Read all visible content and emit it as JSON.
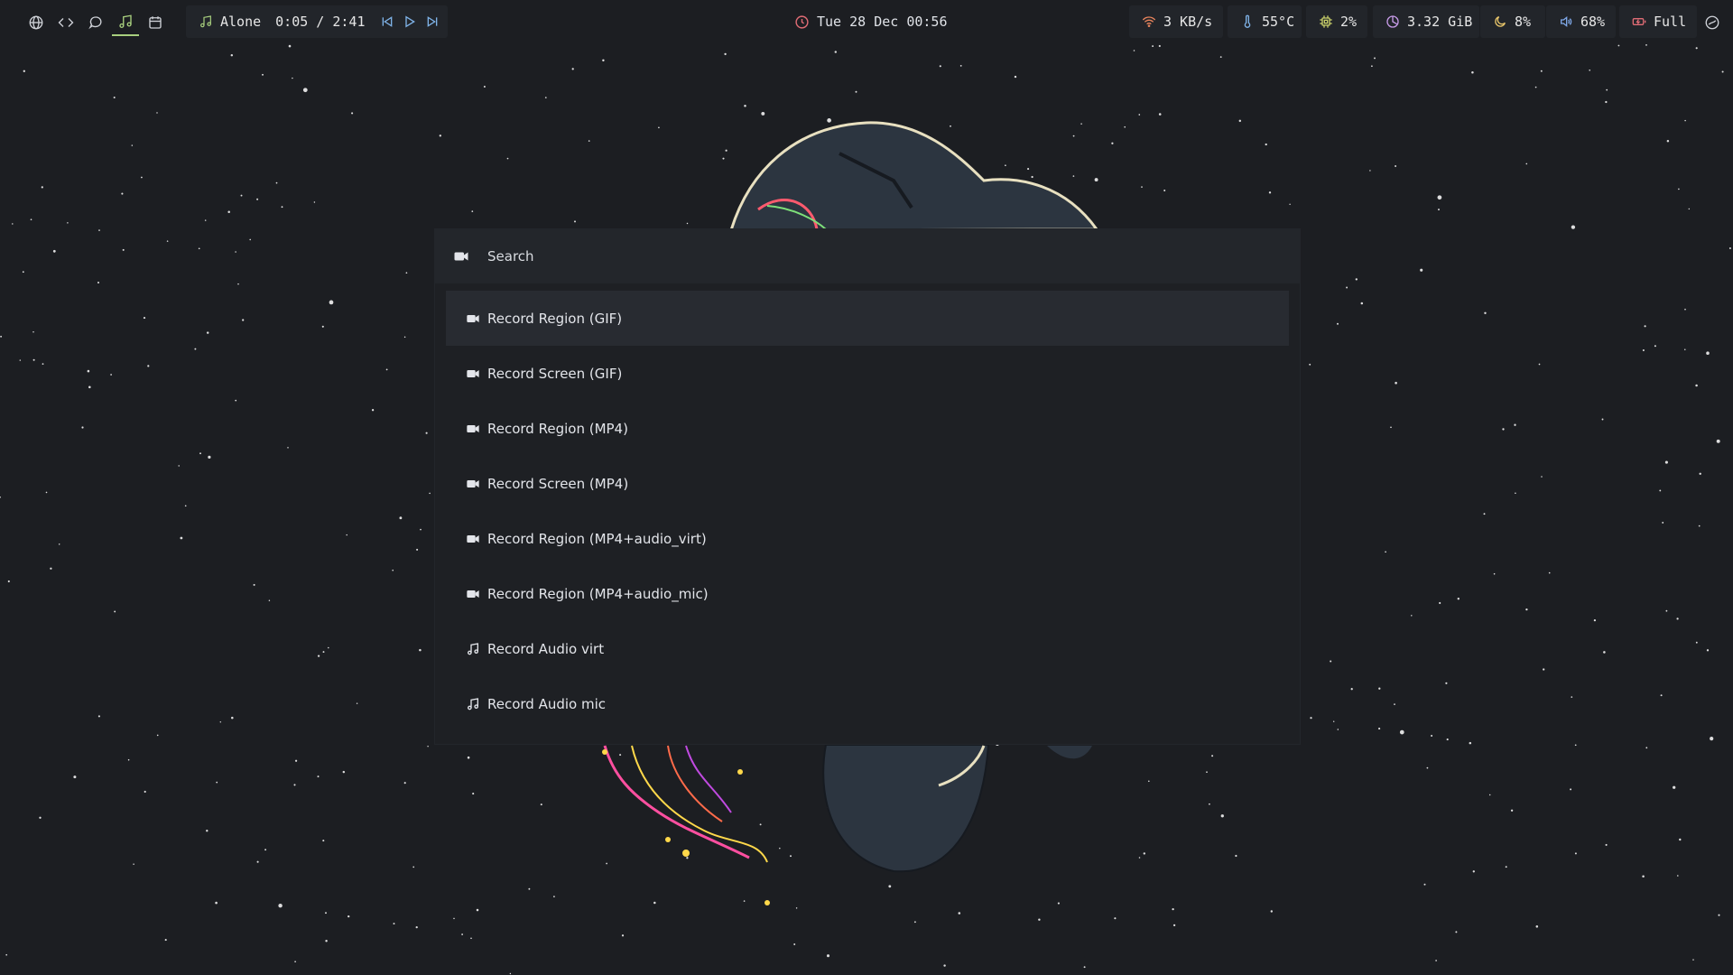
{
  "bar": {
    "workspaces": [
      {
        "icon": "globe-icon",
        "active": false
      },
      {
        "icon": "code-icon",
        "active": false
      },
      {
        "icon": "chat-icon",
        "active": false
      },
      {
        "icon": "music-note-icon",
        "active": true
      },
      {
        "icon": "calendar-icon",
        "active": false
      }
    ],
    "media": {
      "title": "Alone",
      "time": "0:05 / 2:41",
      "icon": "music-note-icon",
      "buttons": [
        "previous-icon",
        "play-icon",
        "next-icon"
      ]
    },
    "clock": {
      "text": "Tue 28 Dec 00:56",
      "icon": "clock-icon"
    },
    "status": {
      "network": {
        "text": "3 KB/s",
        "icon": "wifi-icon",
        "color": "#e8845c"
      },
      "temperature": {
        "text": "55°C",
        "icon": "thermometer-icon",
        "color": "#7fb3e8"
      },
      "cpu": {
        "text": "2%",
        "icon": "cpu-icon",
        "color": "#c9d06a"
      },
      "memory": {
        "text": "3.32 GiB",
        "icon": "memory-icon",
        "color": "#c79be8"
      },
      "brightness": {
        "text": "8%",
        "icon": "moon-icon",
        "color": "#e8c56a"
      },
      "volume": {
        "text": "68%",
        "icon": "speaker-icon",
        "color": "#7fa8e8"
      },
      "battery": {
        "text": "Full",
        "icon": "battery-icon",
        "color": "#e06c75"
      },
      "power": {
        "icon": "power-icon"
      }
    },
    "accent": "#a8cf7e"
  },
  "launcher": {
    "search": {
      "placeholder": "Search",
      "icon": "video-camera-icon"
    },
    "items": [
      {
        "label": "Record Region (GIF)",
        "icon": "video-camera-icon",
        "selected": true
      },
      {
        "label": "Record Screen (GIF)",
        "icon": "video-camera-icon",
        "selected": false
      },
      {
        "label": "Record Region (MP4)",
        "icon": "video-camera-icon",
        "selected": false
      },
      {
        "label": "Record Screen (MP4)",
        "icon": "video-camera-icon",
        "selected": false
      },
      {
        "label": "Record Region (MP4+audio_virt)",
        "icon": "video-camera-icon",
        "selected": false
      },
      {
        "label": "Record Region (MP4+audio_mic)",
        "icon": "video-camera-icon",
        "selected": false
      },
      {
        "label": "Record Audio virt",
        "icon": "music-note-icon",
        "selected": false
      },
      {
        "label": "Record Audio mic",
        "icon": "music-note-icon",
        "selected": false
      }
    ]
  }
}
